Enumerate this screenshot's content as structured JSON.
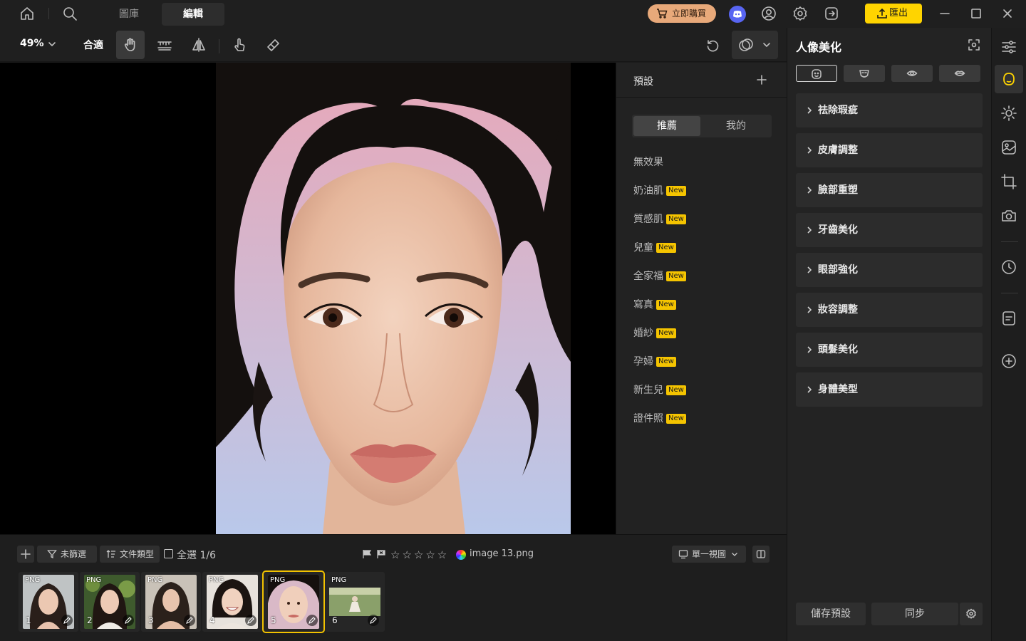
{
  "titlebar": {
    "tabs": [
      {
        "label": "圖庫",
        "active": false
      },
      {
        "label": "編輯",
        "active": true
      }
    ],
    "buy_label": "立即購買",
    "export_label": "匯出",
    "accent_color": "#ffd400",
    "buy_color": "#e8a97a"
  },
  "toolbar": {
    "zoom": "49%",
    "fit_label": "合適",
    "tools": [
      "hand-icon",
      "ruler-icon",
      "flip-icon",
      "touch-icon",
      "eraser-icon"
    ]
  },
  "presets": {
    "title": "預設",
    "segments": [
      {
        "label": "推薦",
        "active": true
      },
      {
        "label": "我的",
        "active": false
      }
    ],
    "items": [
      {
        "label": "無效果",
        "badge": ""
      },
      {
        "label": "奶油肌",
        "badge": "New"
      },
      {
        "label": "質感肌",
        "badge": "New"
      },
      {
        "label": "兒童",
        "badge": "New"
      },
      {
        "label": "全家福",
        "badge": "New"
      },
      {
        "label": "寫真",
        "badge": "New"
      },
      {
        "label": "婚紗",
        "badge": "New"
      },
      {
        "label": "孕婦",
        "badge": "New"
      },
      {
        "label": "新生兒",
        "badge": "New"
      },
      {
        "label": "證件照",
        "badge": "New"
      }
    ]
  },
  "rightpanel": {
    "title": "人像美化",
    "sections": [
      "祛除瑕疵",
      "皮膚調整",
      "臉部重塑",
      "牙齒美化",
      "眼部強化",
      "妝容調整",
      "頭髮美化",
      "身體美型"
    ],
    "save_preset_label": "儲存預設",
    "sync_label": "同步"
  },
  "bottombar": {
    "filter_label": "未篩選",
    "sort_label": "文件類型",
    "select_all_label": "全選 1/6",
    "filename": "image 13.png",
    "view_label": "單一視圖",
    "thumbnails": [
      {
        "format": "PNG",
        "number": "1"
      },
      {
        "format": "PNG",
        "number": "2"
      },
      {
        "format": "PNG",
        "number": "3"
      },
      {
        "format": "PNG",
        "number": "4"
      },
      {
        "format": "PNG",
        "number": "5"
      },
      {
        "format": "PNG",
        "number": "6"
      }
    ]
  }
}
